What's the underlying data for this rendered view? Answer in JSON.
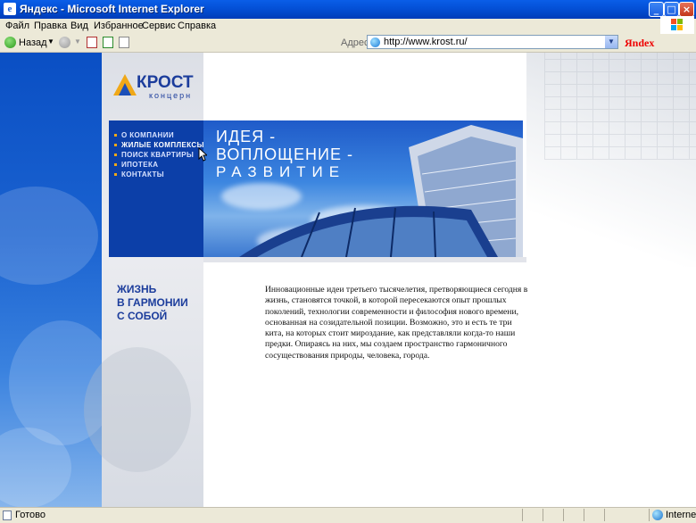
{
  "window": {
    "title": "Яндекс - Microsoft Internet Explorer",
    "buttons": {
      "minimize": "_",
      "maximize": "□",
      "close": "×"
    }
  },
  "menu": [
    "Файл",
    "Правка",
    "Вид",
    "Избранное",
    "Сервис",
    "Справка"
  ],
  "toolbar": {
    "back_label": "Назад",
    "address_label": "Адрес:",
    "address_value": "http://www.krost.ru/",
    "yandex": "Яndex"
  },
  "site": {
    "logo": {
      "brand": "КРОСТ",
      "sub": "концерн"
    },
    "nav": [
      {
        "label": "О КОМПАНИИ",
        "active": false
      },
      {
        "label": "ЖИЛЫЕ КОМПЛЕКСЫ",
        "active": true
      },
      {
        "label": "ПОИСК КВАРТИРЫ",
        "active": false
      },
      {
        "label": "ИПОТЕКА",
        "active": false
      },
      {
        "label": "КОНТАКТЫ",
        "active": false
      }
    ],
    "slogan": [
      "ИДЕЯ -",
      "ВОПЛОЩЕНИЕ -",
      "РАЗВИТИЕ"
    ],
    "tagline": [
      "ЖИЗНЬ",
      "В ГАРМОНИИ",
      "С СОБОЙ"
    ],
    "body": "Инновационные идеи третьего тысячелетия, претворяющиеся сегодня в жизнь, становятся точкой, в которой пересекаются опыт прошлых поколений, технологии современности и философия нового времени, основанная на созидательной позиции. Возможно, это и есть те три кита, на которых стоит мироздание, как представляли когда-то наши предки. Опираясь на них, мы создаем пространство гармоничного сосуществования природы, человека, города."
  },
  "status": {
    "text": "Готово",
    "zone": "Internet"
  },
  "colors": {
    "titlebar": "#0450d6",
    "chrome": "#ece9d8",
    "brand_blue": "#1c3d9c",
    "accent": "#f0a818"
  }
}
